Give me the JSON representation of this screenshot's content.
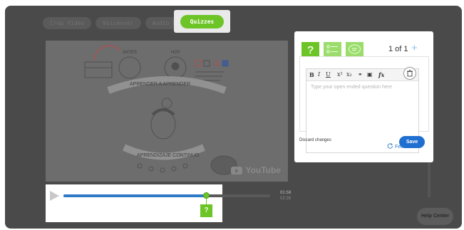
{
  "tabs": [
    "Crop Video",
    "Voiceover",
    "Audio Notes"
  ],
  "quiz_tab": "Quizzes",
  "video": {
    "watermark": "YouTube",
    "drawing_text": [
      "ANTES",
      "HOY",
      "APRENDER A APRENDER",
      "APRENDIZAJE CONTINUO"
    ]
  },
  "player": {
    "progress": 0.69,
    "time_current": "01:58",
    "time_total": "02:28",
    "marker_label": "?"
  },
  "quiz_panel": {
    "page_count": "1 of 1",
    "add_symbol": "+",
    "toolbar": [
      "B",
      "I",
      "U",
      "x²",
      "x₂",
      "⚭",
      "▣",
      "fx"
    ],
    "placeholder": "Type your open ended question here",
    "feedback_label": "Feedback",
    "discard_label": "Discard changes",
    "save_label": "Save"
  },
  "help_label": "Help Center",
  "colors": {
    "accent_green": "#6dc427",
    "light_green": "#9bdc6d",
    "blue": "#2f7ac7",
    "save_blue": "#1f6fd1"
  },
  "icons": [
    "question-icon",
    "multiple-choice-icon",
    "speech-bubble-icon",
    "plus-icon",
    "trash-icon",
    "refresh-icon",
    "play-icon",
    "youtube-icon"
  ]
}
